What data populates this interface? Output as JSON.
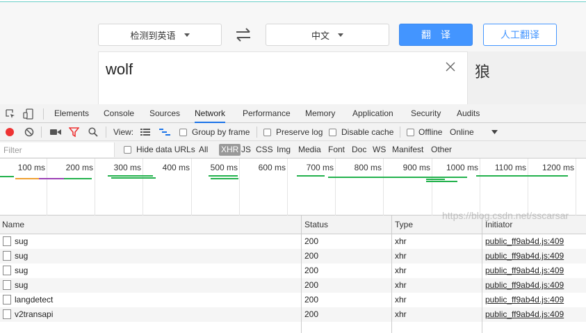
{
  "translator": {
    "source_lang": "检测到英语",
    "target_lang": "中文",
    "translate_button": "翻译",
    "human_translate_button": "人工翻译",
    "input_text": "wolf",
    "output_text": "狼"
  },
  "devtools": {
    "tabs": [
      "Elements",
      "Console",
      "Sources",
      "Network",
      "Performance",
      "Memory",
      "Application",
      "Security",
      "Audits"
    ],
    "active_tab": "Network",
    "toolbar": {
      "view_label": "View:",
      "group_by_frame": "Group by frame",
      "preserve_log": "Preserve log",
      "disable_cache": "Disable cache",
      "offline": "Offline",
      "throttle": "Online"
    },
    "filter": {
      "placeholder": "Filter",
      "hide_data_urls": "Hide data URLs",
      "types": [
        "All",
        "XHR",
        "JS",
        "CSS",
        "Img",
        "Media",
        "Font",
        "Doc",
        "WS",
        "Manifest",
        "Other"
      ],
      "active_type": "XHR"
    },
    "timeline_ticks": [
      "100 ms",
      "200 ms",
      "300 ms",
      "400 ms",
      "500 ms",
      "600 ms",
      "700 ms",
      "800 ms",
      "900 ms",
      "1000 ms",
      "1100 ms",
      "1200 ms"
    ],
    "table": {
      "columns": [
        "Name",
        "Status",
        "Type",
        "Initiator"
      ],
      "rows": [
        {
          "name": "sug",
          "status": "200",
          "type": "xhr",
          "initiator": "public_ff9ab4d.js:409"
        },
        {
          "name": "sug",
          "status": "200",
          "type": "xhr",
          "initiator": "public_ff9ab4d.js:409"
        },
        {
          "name": "sug",
          "status": "200",
          "type": "xhr",
          "initiator": "public_ff9ab4d.js:409"
        },
        {
          "name": "sug",
          "status": "200",
          "type": "xhr",
          "initiator": "public_ff9ab4d.js:409"
        },
        {
          "name": "langdetect",
          "status": "200",
          "type": "xhr",
          "initiator": "public_ff9ab4d.js:409"
        },
        {
          "name": "v2transapi",
          "status": "200",
          "type": "xhr",
          "initiator": "public_ff9ab4d.js:409"
        }
      ]
    }
  },
  "watermark": "https://blog.csdn.net/sscarsar",
  "colors": {
    "accent": "#4395ff",
    "record_red": "#e33",
    "filter_red": "#e33",
    "waterfall_green": "#22b14c",
    "waterfall_orange": "#f0a030",
    "waterfall_purple": "#9b3fb5",
    "active_tab_blue": "#1a73e8"
  }
}
